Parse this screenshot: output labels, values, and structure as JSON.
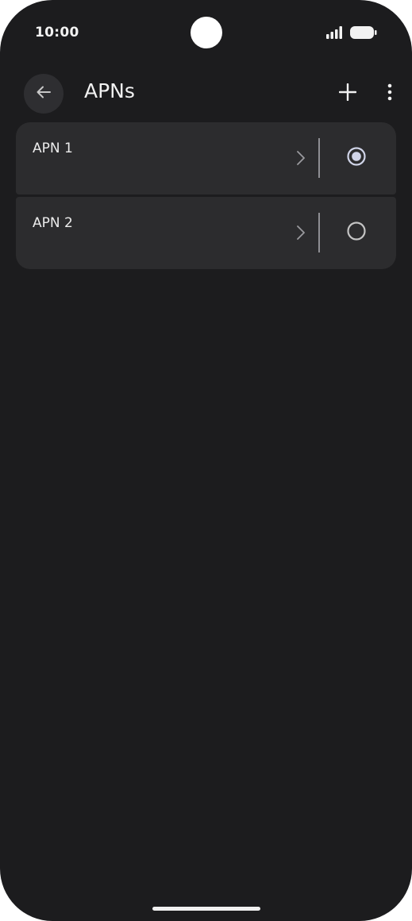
{
  "status_bar": {
    "time": "10:00",
    "signal_icon": "signal-icon",
    "battery_icon": "battery-icon"
  },
  "app_bar": {
    "title": "APNs",
    "back_icon": "arrow-back-icon",
    "add_icon": "plus-icon",
    "overflow_icon": "more-vert-icon"
  },
  "apns": [
    {
      "name": "APN 1",
      "selected": true
    },
    {
      "name": "APN 2",
      "selected": false
    }
  ],
  "colors": {
    "background": "#1c1c1e",
    "card": "#2c2c2e",
    "text": "#ececec",
    "radio_selected": "#d0d4e8",
    "radio_unselected": "#c4c4c4"
  }
}
